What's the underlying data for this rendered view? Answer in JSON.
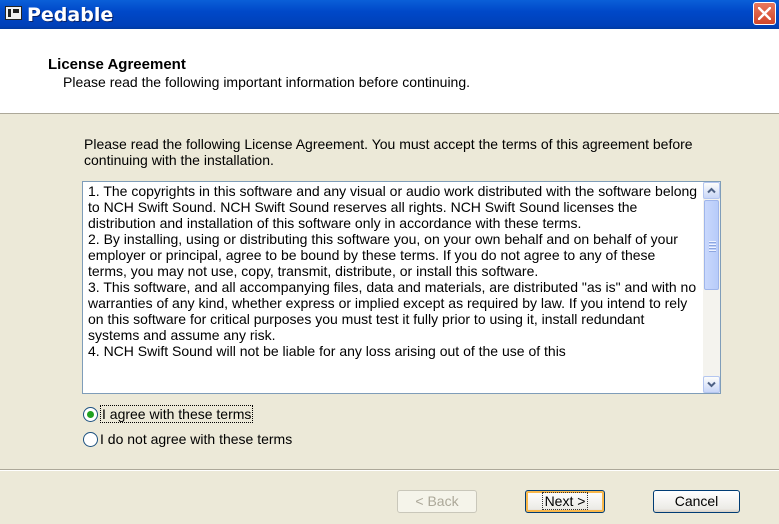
{
  "window": {
    "title": "Pedable"
  },
  "header": {
    "title": "License Agreement",
    "subtitle": "Please read the following important information before continuing."
  },
  "intro": "Please read the following License Agreement. You must accept the terms of this agreement before continuing with the installation.",
  "license": {
    "text": "1. The copyrights in this software and any visual or audio work distributed with the software belong to NCH Swift Sound. NCH Swift Sound reserves all rights. NCH Swift Sound licenses the distribution and installation of this software only in accordance with these terms.\n2. By installing, using or distributing this software you, on your own behalf and on behalf of your employer or principal, agree to be bound by these terms. If you do not agree to any of these terms, you may not use, copy, transmit, distribute, or install this software.\n3. This software, and all accompanying files, data and materials, are distributed \"as is\" and with no warranties of any kind, whether express or implied except as required by law. If you intend to rely on this software for critical purposes you must test it fully prior to using it, install redundant systems and assume any risk.\n4. NCH Swift Sound will not be liable for any loss arising out of the use of this",
    "scroll_position": 0.0
  },
  "options": {
    "agree": {
      "label": "I agree with these terms",
      "checked": true
    },
    "disagree": {
      "label": "I do not agree with these terms",
      "checked": false
    }
  },
  "buttons": {
    "back": "< Back",
    "next": "Next >",
    "cancel": "Cancel"
  },
  "colors": {
    "titlebar": "#0048c8",
    "dialog_bg": "#ece9d8",
    "close_button": "#d2452a",
    "radio_selected": "#21a121"
  },
  "icons": {
    "app": "app-icon",
    "close": "close-icon",
    "scroll_up": "chevron-up-icon",
    "scroll_down": "chevron-down-icon"
  }
}
